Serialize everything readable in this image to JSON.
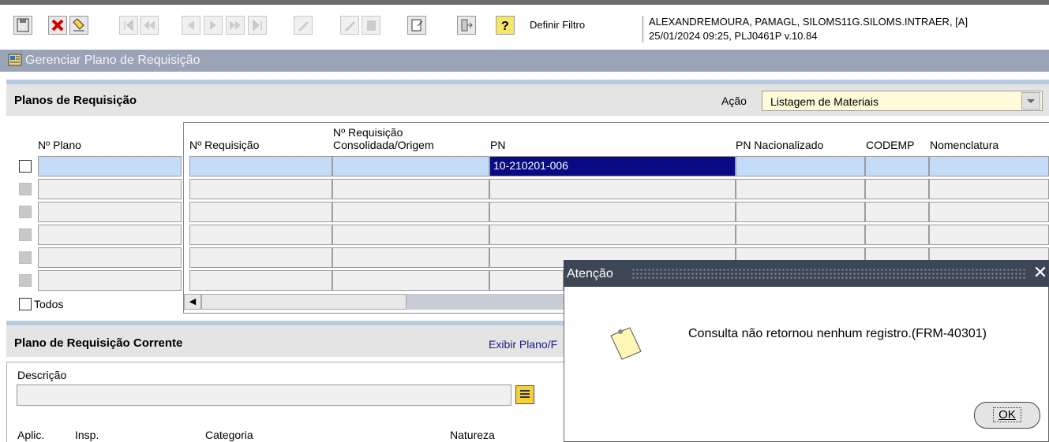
{
  "toolbar": {
    "filter_label": "Definir Filtro",
    "session_line1": "ALEXANDREMOURA, PAMAGL, SILOMS11G.SILOMS.INTRAER, [A]",
    "session_line2": "25/01/2024 09:25, PLJ0461P v.10.84"
  },
  "window": {
    "title": "Gerenciar Plano de Requisição"
  },
  "planos": {
    "title": "Planos de Requisição",
    "acao_label": "Ação",
    "acao_value": "Listagem de Materiais",
    "columns": {
      "plano": "Nº Plano",
      "requisicao": "Nº Requisição",
      "consolidada_l1": "Nº Requisição",
      "consolidada_l2": "Consolidada/Origem",
      "pn": "PN",
      "pn_nacional": "PN Nacionalizado",
      "codemp": "CODEMP",
      "nomenclatura": "Nomenclatura"
    },
    "rows": [
      {
        "pn": "10-210201-006"
      },
      {
        "pn": ""
      },
      {
        "pn": ""
      },
      {
        "pn": ""
      },
      {
        "pn": ""
      },
      {
        "pn": ""
      }
    ],
    "todos_label": "Todos"
  },
  "corrente": {
    "title": "Plano de Requisição Corrente",
    "exibir_label": "Exibir Plano/F",
    "descricao_label": "Descrição",
    "bottom_labels": {
      "aplic": "Aplic.",
      "insp": "Insp.",
      "categoria": "Categoria",
      "natureza": "Natureza"
    }
  },
  "dialog": {
    "title": "Atenção",
    "message": "Consulta não retornou nenhum registro.(FRM-40301)",
    "ok_label": "OK"
  }
}
